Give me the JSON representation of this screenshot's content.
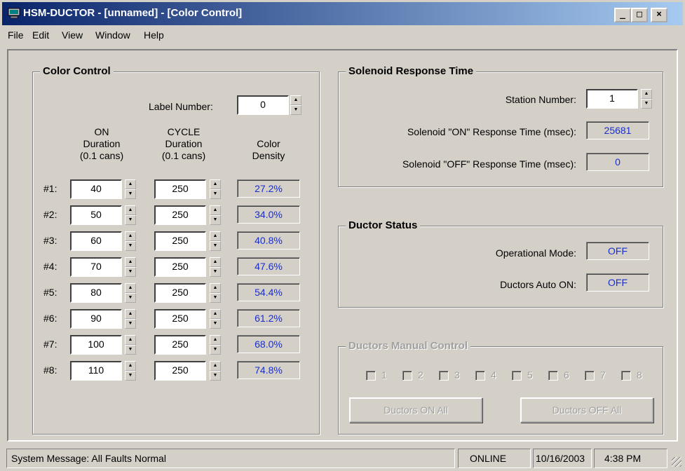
{
  "window": {
    "title": "HSM-DUCTOR - [unnamed] - [Color Control]",
    "controls": {
      "minimize": "_",
      "maximize": "□",
      "close": "×"
    }
  },
  "menu": [
    "File",
    "Edit",
    "View",
    "Window",
    "Help"
  ],
  "color_control": {
    "title": "Color Control",
    "label_number_label": "Label Number:",
    "label_number_value": "0",
    "headers": {
      "on": [
        "ON",
        "Duration",
        "(0.1 cans)"
      ],
      "cycle": [
        "CYCLE",
        "Duration",
        "(0.1 cans)"
      ],
      "density": [
        "Color",
        "Density"
      ]
    },
    "rows": [
      {
        "label": "#1:",
        "on": "40",
        "cycle": "250",
        "density": "27.2%"
      },
      {
        "label": "#2:",
        "on": "50",
        "cycle": "250",
        "density": "34.0%"
      },
      {
        "label": "#3:",
        "on": "60",
        "cycle": "250",
        "density": "40.8%"
      },
      {
        "label": "#4:",
        "on": "70",
        "cycle": "250",
        "density": "47.6%"
      },
      {
        "label": "#5:",
        "on": "80",
        "cycle": "250",
        "density": "54.4%"
      },
      {
        "label": "#6:",
        "on": "90",
        "cycle": "250",
        "density": "61.2%"
      },
      {
        "label": "#7:",
        "on": "100",
        "cycle": "250",
        "density": "68.0%"
      },
      {
        "label": "#8:",
        "on": "110",
        "cycle": "250",
        "density": "74.8%"
      }
    ]
  },
  "solenoid": {
    "title": "Solenoid Response Time",
    "station_label": "Station Number:",
    "station_value": "1",
    "on_label": "Solenoid \"ON\" Response Time (msec):",
    "on_value": "25681",
    "off_label": "Solenoid \"OFF\" Response Time (msec):",
    "off_value": "0"
  },
  "ductor_status": {
    "title": "Ductor Status",
    "mode_label": "Operational Mode:",
    "mode_value": "OFF",
    "auto_label": "Ductors Auto ON:",
    "auto_value": "OFF"
  },
  "manual_control": {
    "title": "Ductors Manual Control",
    "checkboxes": [
      "1",
      "2",
      "3",
      "4",
      "5",
      "6",
      "7",
      "8"
    ],
    "on_all": "Ductors ON All",
    "off_all": "Ductors OFF All"
  },
  "statusbar": {
    "message": "System Message:  All Faults Normal",
    "online": "ONLINE",
    "date": "10/16/2003",
    "time": "4:38 PM"
  },
  "colors": {
    "title_gradient_start": "#0a246a",
    "title_gradient_end": "#a6caf0",
    "readout_text": "#1a2ecc",
    "face": "#d4d0c8"
  }
}
